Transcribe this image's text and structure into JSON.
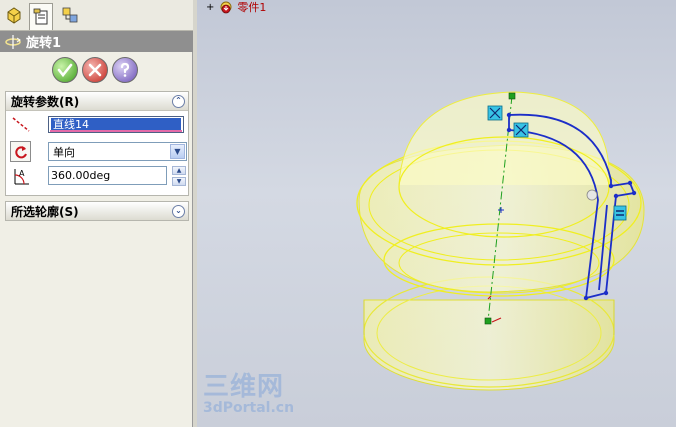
{
  "tabs": [
    {
      "name": "feature-manager",
      "icon": "feature-tree-icon"
    },
    {
      "name": "property-manager",
      "icon": "property-manager-icon"
    },
    {
      "name": "configuration-manager",
      "icon": "configuration-manager-icon"
    }
  ],
  "feature": {
    "title": "旋转1",
    "icon": "revolve-icon"
  },
  "actions": {
    "ok": "ok-icon",
    "cancel": "cancel-icon",
    "help": "help-icon"
  },
  "revolve_params": {
    "header": "旋转参数(R)",
    "axis_value": "直线14",
    "direction_type": "单向",
    "angle_value": "360.00deg"
  },
  "selected_contours": {
    "header": "所选轮廓(S)"
  },
  "tree": {
    "expand": "+",
    "part_name": "零件1"
  },
  "watermark": {
    "line1": "三维网",
    "line2": "3dPortal.cn"
  },
  "colors": {
    "model_yellow": "#ffff66",
    "model_edge": "#e6e600",
    "sketch_blue": "#1c2ec8",
    "axis_green": "#1fa01f",
    "title_bar": "#8f8f8f"
  }
}
